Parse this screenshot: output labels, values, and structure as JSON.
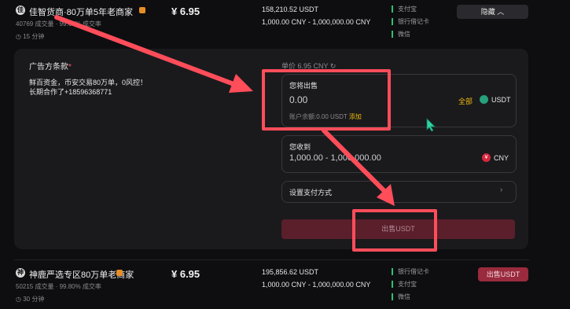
{
  "row1": {
    "merchant": "佳智货商·80万单5年老商家",
    "stats": "40769 成交量 · 99.60% 成交率",
    "time": "15 分钟",
    "price": "¥ 6.95",
    "amount": "158,210.52 USDT",
    "limit": "1,000.00 CNY - 1,000,000.00 CNY",
    "payments": [
      "支付宝",
      "银行借记卡",
      "微信"
    ],
    "collapse_label": "隐藏"
  },
  "panel": {
    "terms_label": "广告方条款",
    "terms_text": [
      "鲜百资金，币安交易80万单，0风控！",
      "长期合作了+18596368771"
    ],
    "unit_price": "单价 6.95 CNY",
    "sell_label": "您将出售",
    "sell_value": "0.00",
    "all_label": "全部",
    "sell_currency": "USDT",
    "balance_text": "账户余额:0.00 USDT",
    "add_label": "添加",
    "receive_label": "您收到",
    "receive_value": "1,000.00 - 1,000,000.00",
    "receive_currency": "CNY",
    "payment_setup": "设置支付方式",
    "sell_button": "出售USDT"
  },
  "row2": {
    "merchant": "神鹿严选专区80万单老商家",
    "stats": "50215 成交量 · 99.80% 成交率",
    "time": "30 分钟",
    "price": "¥ 6.95",
    "amount": "195,856.62 USDT",
    "limit": "1,000.00 CNY - 1,000,000.00 CNY",
    "payments": [
      "银行借记卡",
      "支付宝",
      "微信"
    ],
    "sell_button": "出售USDT"
  },
  "colors": {
    "accent_yellow": "#f0b90b",
    "annotation_red": "#ff4d5a",
    "sell_button": "#5a1f2b"
  }
}
